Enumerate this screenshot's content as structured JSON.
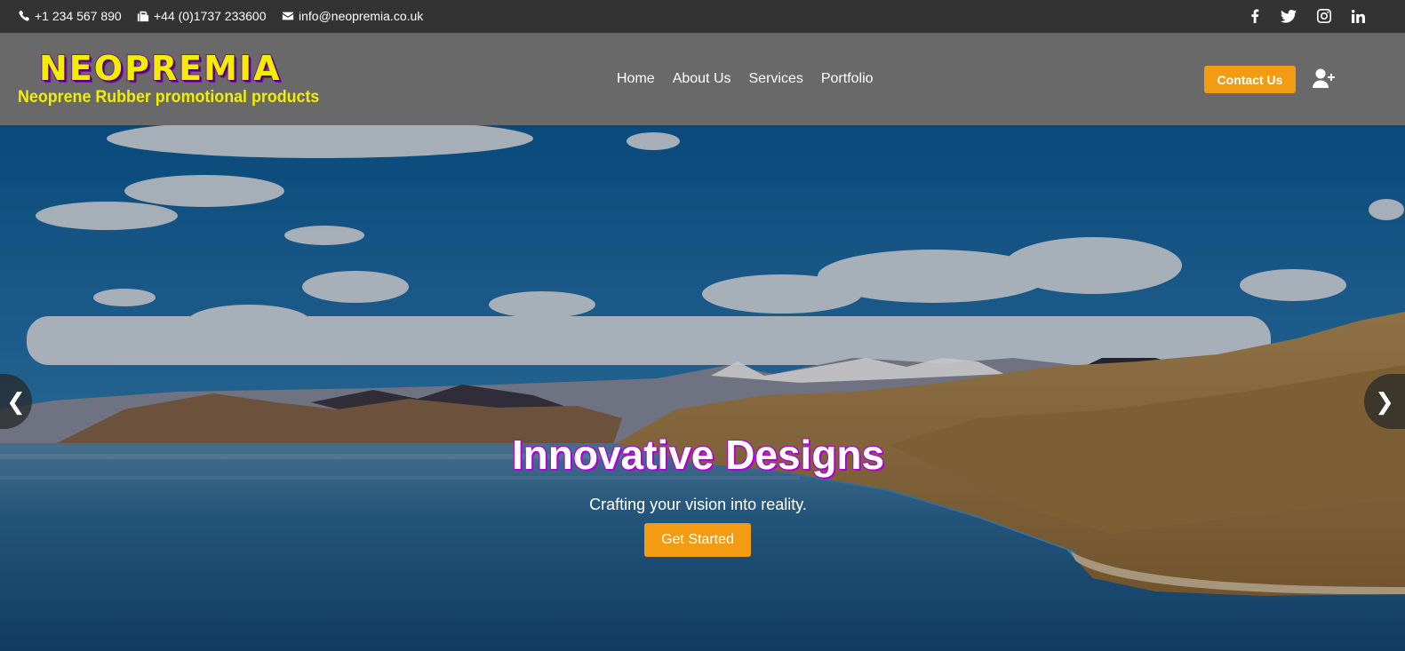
{
  "topbar": {
    "phone": {
      "icon": "phone-icon",
      "text": "+1 234 567 890"
    },
    "fax": {
      "icon": "fax-icon",
      "text": "+44 (0)1737 233600"
    },
    "email": {
      "icon": "envelope-icon",
      "text": "info@neopremia.co.uk"
    },
    "social": [
      "facebook-icon",
      "twitter-icon",
      "instagram-icon",
      "linkedin-icon"
    ]
  },
  "header": {
    "logo_text": "NEOPREMIA",
    "logo_tagline": "Neoprene Rubber promotional products",
    "nav": [
      {
        "label": "Home"
      },
      {
        "label": "About Us"
      },
      {
        "label": "Services"
      },
      {
        "label": "Portfolio"
      }
    ],
    "contact_button": "Contact Us",
    "user_icon": "user-plus-icon"
  },
  "hero": {
    "title": "Innovative Designs",
    "subtitle": "Crafting your vision into reality.",
    "button": "Get Started",
    "prev_arrow": "❮",
    "next_arrow": "❯"
  },
  "colors": {
    "topbar_bg": "#333333",
    "header_bg": "#696969",
    "accent": "#f39c12",
    "logo_yellow": "#f2ee00",
    "logo_purple": "#7d12a8"
  }
}
